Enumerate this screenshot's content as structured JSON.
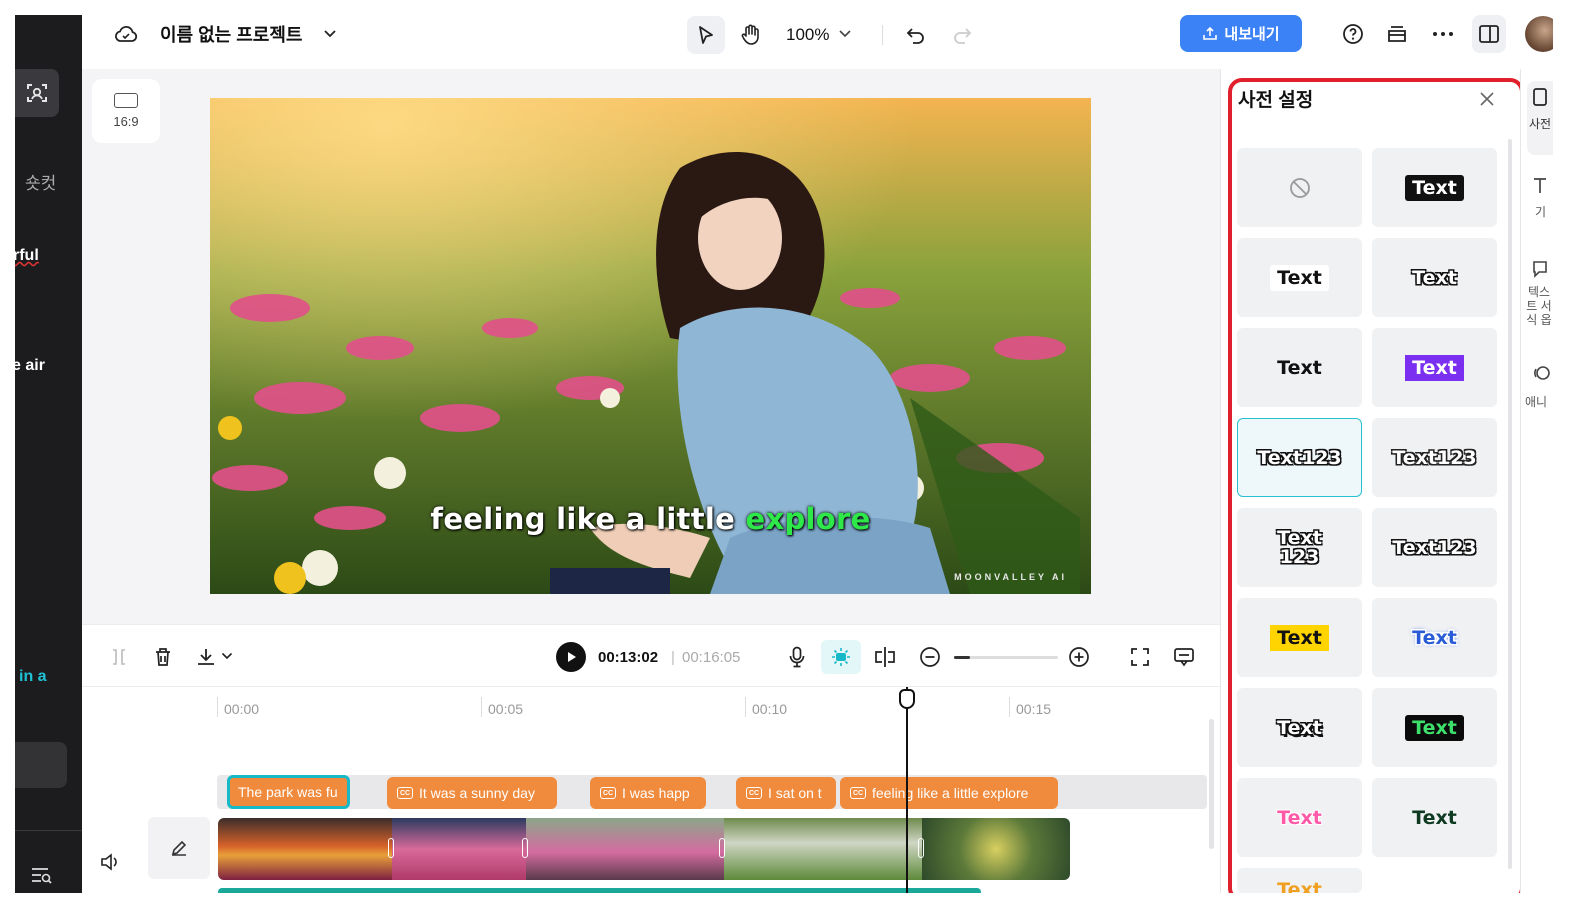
{
  "topbar": {
    "project_title": "이름 없는 프로젝트",
    "zoom": "100%",
    "export_label": "내보내기"
  },
  "left_rail": {
    "shortcut_label": "숏컷",
    "snippets": [
      "rful",
      "e air",
      "in a"
    ]
  },
  "preview": {
    "aspect_ratio": "16:9",
    "caption_prefix": "feeling like a little",
    "caption_highlight": "explore",
    "watermark": "MOONVALLEY AI"
  },
  "controls": {
    "current_time": "00:13:02",
    "separator": "|",
    "total_time": "00:16:05"
  },
  "timeline": {
    "ruler": [
      "00:00",
      "00:05",
      "00:10",
      "00:15"
    ],
    "captions": [
      "The park was fu",
      "It was a sunny day",
      "I was happ",
      "I sat on t",
      "feeling like a little explore"
    ]
  },
  "panel": {
    "title": "사전 설정",
    "presets": [
      "",
      "Text",
      "Text",
      "Text",
      "Text",
      "Text",
      "Text123",
      "Text123",
      "Text 123",
      "Text123",
      "Text",
      "Text",
      "Text",
      "Text",
      "Text",
      "Text",
      "Text"
    ]
  },
  "side_tabs": {
    "labels": [
      "사전",
      "기",
      "텍스트 서식 옵",
      "애니"
    ]
  },
  "colors": {
    "accent": "#3b82f6",
    "highlight_border": "#e0202c",
    "caption_chip": "#f08a3c",
    "selection": "#18b9c7",
    "caption_highlight": "#2ee84a"
  }
}
